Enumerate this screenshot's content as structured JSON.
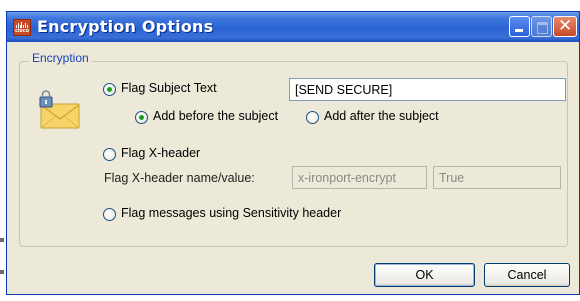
{
  "window": {
    "title": "Encryption Options",
    "app_logo_word": "cisco"
  },
  "group": {
    "legend": "Encryption"
  },
  "options": {
    "flag_subject": {
      "label": "Flag Subject Text",
      "selected": true,
      "value": "[SEND SECURE]"
    },
    "add_before": {
      "label": "Add before the subject",
      "selected": true
    },
    "add_after": {
      "label": "Add after the subject",
      "selected": false
    },
    "flag_xheader": {
      "label": "Flag X-header",
      "selected": false
    },
    "xheader_name_value": {
      "label": "Flag X-header name/value:",
      "name": "x-ironport-encrypt",
      "value": "True"
    },
    "flag_sensitivity": {
      "label": "Flag messages using Sensitivity header",
      "selected": false
    }
  },
  "buttons": {
    "ok": "OK",
    "cancel": "Cancel"
  },
  "colors": {
    "titlebar": "#2a63d3",
    "legend_text": "#1a3fbf",
    "radio_dot": "#1f9c1f",
    "dialog_bg": "#ece9d8"
  }
}
